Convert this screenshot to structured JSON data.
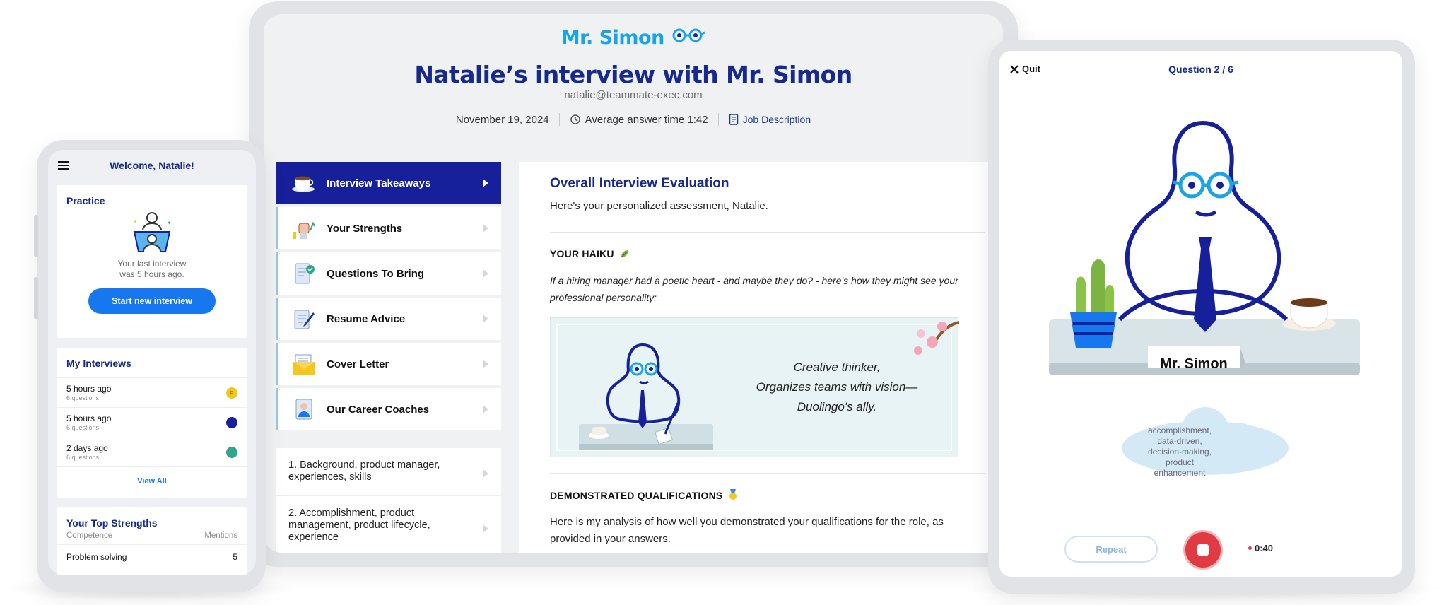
{
  "brand": {
    "name": "Mr. Simon",
    "color": "#1aa3e8",
    "navy": "#152a8c"
  },
  "center": {
    "title": "Natalie’s interview with Mr. Simon",
    "email": "natalie@teammate-exec.com",
    "date": "November 19, 2024",
    "avg_time": "Average answer time 1:42",
    "job_description": "Job Description",
    "menu": [
      {
        "label": "Interview Takeaways",
        "icon": "coffee-cup-icon",
        "active": true
      },
      {
        "label": "Your Strengths",
        "icon": "fist-growth-icon",
        "active": false
      },
      {
        "label": "Questions To Bring",
        "icon": "document-check-icon",
        "active": false
      },
      {
        "label": "Resume Advice",
        "icon": "resume-pen-icon",
        "active": false
      },
      {
        "label": "Cover Letter",
        "icon": "envelope-icon",
        "active": false
      },
      {
        "label": "Our Career Coaches",
        "icon": "coach-portrait-icon",
        "active": false
      }
    ],
    "questions": [
      "1. Background, product manager, experiences, skills",
      "2. Accomplishment, product management, product lifecycle, experience"
    ],
    "content": {
      "title": "Overall Interview Evaluation",
      "intro": "Here's your personalized assessment, Natalie.",
      "haiku_heading": "YOUR HAIKU",
      "haiku_lead": "If a hiring manager had a poetic heart - and maybe they do? - here's how they might see your professional personality:",
      "haiku_lines": [
        "Creative thinker,",
        "Organizes teams with vision—",
        "Duolingo's ally."
      ],
      "qual_heading": "DEMONSTRATED QUALIFICATIONS",
      "qual_body": "Here is my analysis of how well you demonstrated your qualifications for the role, as provided in your answers."
    }
  },
  "phone": {
    "welcome": "Welcome, Natalie!",
    "practice": {
      "title": "Practice",
      "line1": "Your last interview",
      "line2": "was 5 hours ago.",
      "button": "Start new interview"
    },
    "interviews": {
      "title": "My Interviews",
      "items": [
        {
          "time": "5 hours ago",
          "questions": "6 questions",
          "color": "#f2c81d"
        },
        {
          "time": "5 hours ago",
          "questions": "6 questions",
          "color": "#15209a"
        },
        {
          "time": "2 days ago",
          "questions": "6 questions",
          "color": "#2fa58c"
        }
      ],
      "view_all": "View All"
    },
    "strengths": {
      "title": "Your Top Strengths",
      "col1": "Competence",
      "col2": "Mentions",
      "rows": [
        {
          "label": "Problem solving",
          "value": "5"
        }
      ]
    }
  },
  "right": {
    "quit": "Quit",
    "question_count": "Question 2 / 6",
    "nameplate": "Mr. Simon",
    "thought": "accomplishment, data-driven, decision-making, product enhancement",
    "repeat": "Repeat",
    "timer": "0:40",
    "stop_color": "#e03a42"
  }
}
